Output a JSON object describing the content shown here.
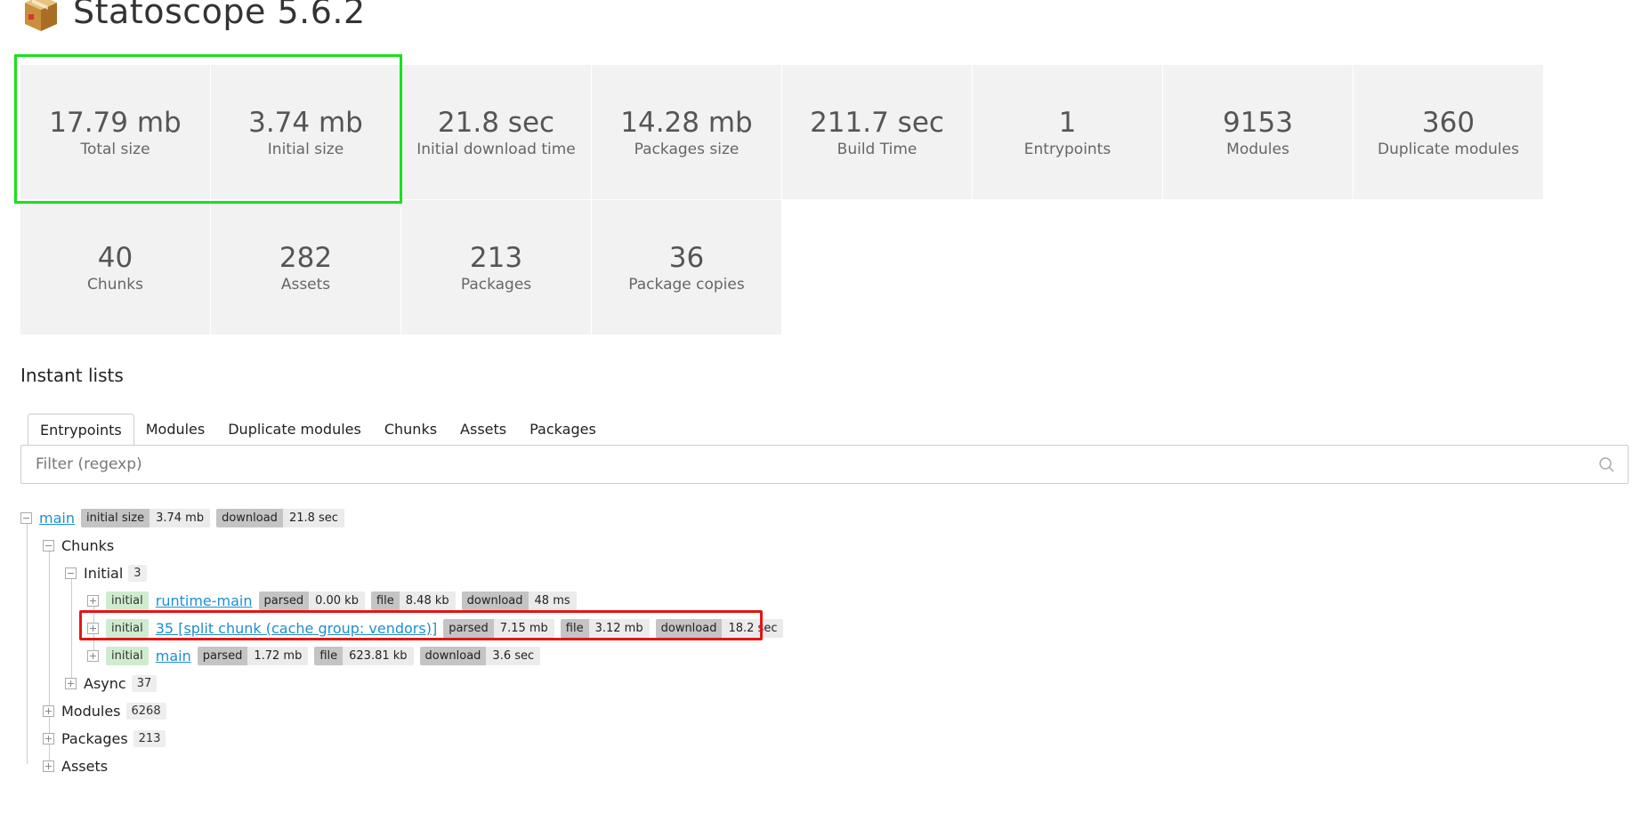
{
  "app": {
    "title": "Statoscope 5.6.2",
    "logo_icon": "package-box-icon"
  },
  "stats": [
    {
      "value": "17.79 mb",
      "label": "Total size"
    },
    {
      "value": "3.74 mb",
      "label": "Initial size"
    },
    {
      "value": "21.8 sec",
      "label": "Initial download time"
    },
    {
      "value": "14.28 mb",
      "label": "Packages size"
    },
    {
      "value": "211.7 sec",
      "label": "Build Time"
    },
    {
      "value": "1",
      "label": "Entrypoints"
    },
    {
      "value": "9153",
      "label": "Modules"
    },
    {
      "value": "360",
      "label": "Duplicate modules"
    },
    {
      "value": "40",
      "label": "Chunks"
    },
    {
      "value": "282",
      "label": "Assets"
    },
    {
      "value": "213",
      "label": "Packages"
    },
    {
      "value": "36",
      "label": "Package copies"
    }
  ],
  "instant_lists": {
    "title": "Instant lists",
    "tabs": [
      {
        "label": "Entrypoints",
        "active": true
      },
      {
        "label": "Modules"
      },
      {
        "label": "Duplicate modules"
      },
      {
        "label": "Chunks"
      },
      {
        "label": "Assets"
      },
      {
        "label": "Packages"
      }
    ],
    "filter_placeholder": "Filter (regexp)"
  },
  "tree": {
    "root": {
      "name": "main",
      "initial_size_key": "initial size",
      "initial_size_val": "3.74 mb",
      "download_key": "download",
      "download_val": "21.8 sec"
    },
    "chunks_label": "Chunks",
    "initial": {
      "label": "Initial",
      "count": "3"
    },
    "chunk_rows": [
      {
        "badge": "initial",
        "name": "runtime-main",
        "parsed_key": "parsed",
        "parsed": "0.00 kb",
        "file_key": "file",
        "file": "8.48 kb",
        "download_key": "download",
        "download": "48 ms"
      },
      {
        "badge": "initial",
        "name": "35 [split chunk (cache group: vendors)]",
        "parsed_key": "parsed",
        "parsed": "7.15 mb",
        "file_key": "file",
        "file": "3.12 mb",
        "download_key": "download",
        "download": "18.2 sec"
      },
      {
        "badge": "initial",
        "name": "main",
        "parsed_key": "parsed",
        "parsed": "1.72 mb",
        "file_key": "file",
        "file": "623.81 kb",
        "download_key": "download",
        "download": "3.6 sec"
      }
    ],
    "async": {
      "label": "Async",
      "count": "37"
    },
    "modules": {
      "label": "Modules",
      "count": "6268"
    },
    "packages": {
      "label": "Packages",
      "count": "213"
    },
    "assets": {
      "label": "Assets"
    }
  },
  "colors": {
    "highlight_green": "#16e31a",
    "highlight_red": "#e31616",
    "link": "#1d8fd1",
    "initial_badge": "#cfeccf"
  }
}
